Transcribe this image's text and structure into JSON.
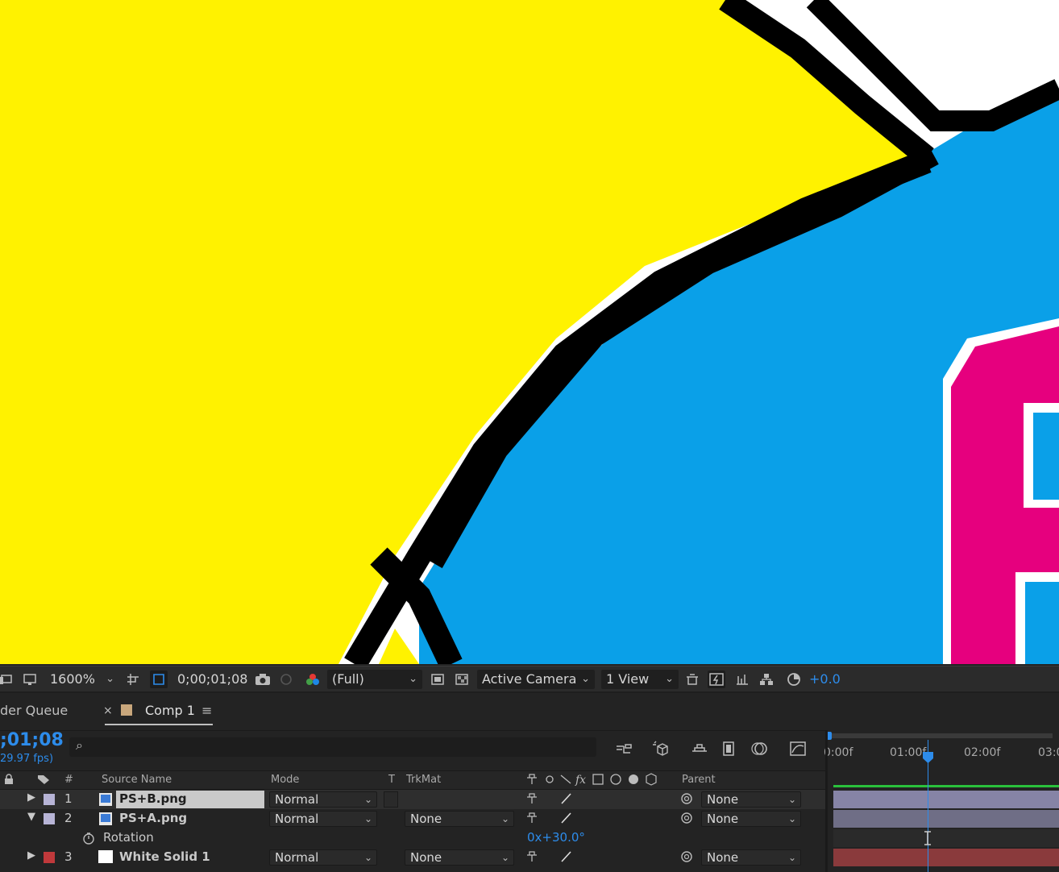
{
  "viewer": {
    "toolbar": {
      "zoom": "1600%",
      "timecode": "0;00;01;08",
      "resolution": "(Full)",
      "camera": "Active Camera",
      "view_layout": "1 View",
      "exposure": "+0.0"
    }
  },
  "panel_tabs": {
    "render_queue": "der Queue",
    "close": "×",
    "comp": "Comp 1",
    "menu": "≡"
  },
  "timeline": {
    "current_time": ";01;08",
    "fps": "29.97 fps)",
    "search_icon": "⌕",
    "columns": {
      "number": "#",
      "source_name": "Source Name",
      "mode": "Mode",
      "t": "T",
      "trkmat": "TrkMat",
      "parent": "Parent"
    },
    "layers": [
      {
        "num": "1",
        "name": "PS+B.png",
        "mode": "Normal",
        "trkmat": "",
        "parent": "None",
        "expand": "▶",
        "label_color": "#b7b4d6"
      },
      {
        "num": "2",
        "name": "PS+A.png",
        "mode": "Normal",
        "trkmat": "None",
        "parent": "None",
        "expand": "▼",
        "label_color": "#b7b4d6"
      },
      {
        "num": "3",
        "name": "White Solid 1",
        "mode": "Normal",
        "trkmat": "None",
        "parent": "None",
        "expand": "▶",
        "label_color": "#c0393b"
      }
    ],
    "property": {
      "name": "Rotation",
      "value": "0x+30.0°"
    },
    "ruler": [
      "0:00f",
      "01:00f",
      "02:00f",
      "03:0"
    ]
  }
}
